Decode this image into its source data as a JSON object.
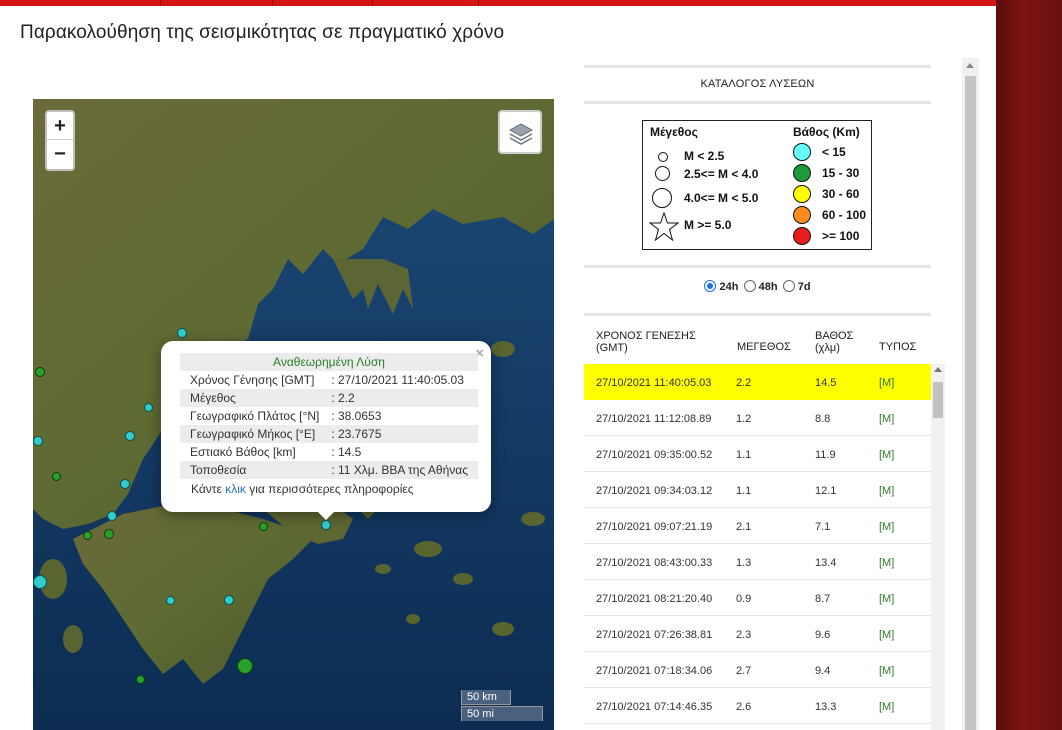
{
  "page": {
    "title": "Παρακολούθηση της σεισμικότητας σε πραγματικό χρόνο"
  },
  "map": {
    "zoom_in_label": "+",
    "zoom_out_label": "−",
    "layers_icon": "layers-icon",
    "scale_km": "50 km",
    "scale_mi": "50 mi",
    "popup": {
      "header": "Αναθεωρημένη Λύση",
      "close": "×",
      "fields": [
        {
          "label": "Χρόνος Γένησης [GMT]",
          "value": ": 27/10/2021 11:40:05.03"
        },
        {
          "label": "Μέγεθος",
          "value": ": 2.2"
        },
        {
          "label": "Γεωγραφικό Πλάτος [°N]",
          "value": ": 38.0653"
        },
        {
          "label": "Γεωγραφικό Μήκος [°E]",
          "value": ": 23.7675"
        },
        {
          "label": "Εστιακό Βάθος [km]",
          "value": ": 14.5"
        },
        {
          "label": "Τοποθεσία",
          "value": ": 11 Χλμ. ΒΒΑ της Αθήνας"
        }
      ],
      "more_prefix": "Κάντε ",
      "more_link": "κλικ",
      "more_suffix": " για περισσότερες πληροφορίες"
    }
  },
  "catalog": {
    "title": "ΚΑΤΑΛΟΓΟΣ ΛΥΣΕΩΝ",
    "legend": {
      "magnitude_header": "Μέγεθος",
      "depth_header": "Βάθος (Km)",
      "magnitudes": [
        "M < 2.5",
        "2.5<= M < 4.0",
        "4.0<= M < 5.0",
        "M >= 5.0"
      ],
      "depths": [
        {
          "label": "< 15",
          "color": "#66ffff"
        },
        {
          "label": "15 - 30",
          "color": "#1f9a3a"
        },
        {
          "label": "30 - 60",
          "color": "#ffff00"
        },
        {
          "label": "60 - 100",
          "color": "#ff8a1e"
        },
        {
          "label": ">= 100",
          "color": "#e81c1c"
        }
      ]
    },
    "periods": [
      {
        "label": "24h",
        "selected": true
      },
      {
        "label": "48h",
        "selected": false
      },
      {
        "label": "7d",
        "selected": false
      }
    ],
    "columns": {
      "time_line1": "ΧΡΟΝΟΣ ΓΕΝΕΣΗΣ",
      "time_line2": "(GMT)",
      "magnitude": "ΜΕΓΕΘΟΣ",
      "depth_line1": "ΒΑΘΟΣ",
      "depth_line2": "(χλμ)",
      "type": "ΤΥΠΟΣ"
    },
    "rows": [
      {
        "time": "27/10/2021 11:40:05.03",
        "mag": "2.2",
        "depth": "14.5",
        "type": "[M]"
      },
      {
        "time": "27/10/2021 11:12:08.89",
        "mag": "1.2",
        "depth": "8.8",
        "type": "[M]"
      },
      {
        "time": "27/10/2021 09:35:00.52",
        "mag": "1.1",
        "depth": "11.9",
        "type": "[M]"
      },
      {
        "time": "27/10/2021 09:34:03.12",
        "mag": "1.1",
        "depth": "12.1",
        "type": "[M]"
      },
      {
        "time": "27/10/2021 09:07:21.19",
        "mag": "2.1",
        "depth": "7.1",
        "type": "[M]"
      },
      {
        "time": "27/10/2021 08:43:00.33",
        "mag": "1.3",
        "depth": "13.4",
        "type": "[M]"
      },
      {
        "time": "27/10/2021 08:21:20.40",
        "mag": "0.9",
        "depth": "8.7",
        "type": "[M]"
      },
      {
        "time": "27/10/2021 07:26:38.81",
        "mag": "2.3",
        "depth": "9.6",
        "type": "[M]"
      },
      {
        "time": "27/10/2021 07:18:34.06",
        "mag": "2.7",
        "depth": "9.4",
        "type": "[M]"
      },
      {
        "time": "27/10/2021 07:14:46.35",
        "mag": "2.6",
        "depth": "13.3",
        "type": "[M]"
      }
    ]
  }
}
